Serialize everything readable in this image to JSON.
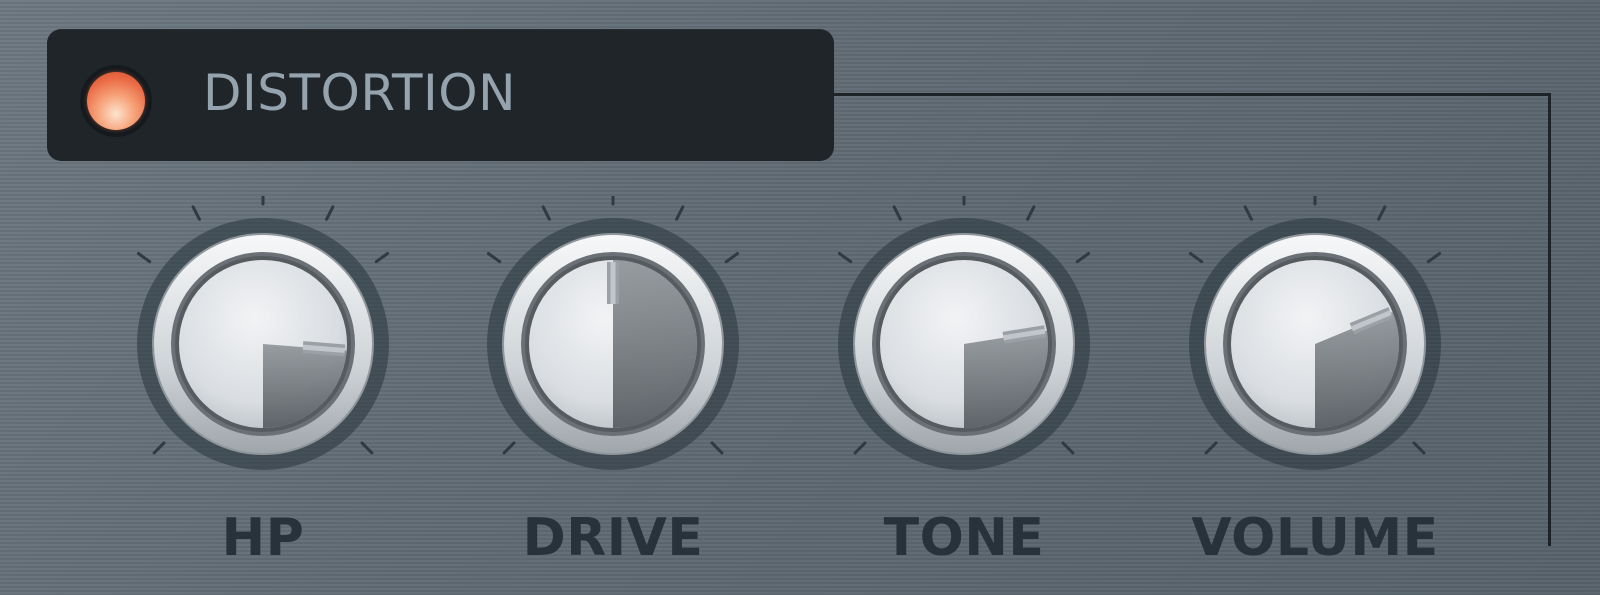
{
  "plugin": {
    "section_title": "DISTORTION",
    "power_led": {
      "state": "on",
      "color": "#ea6a45"
    }
  },
  "knobs": [
    {
      "id": "hp",
      "label": "HP",
      "value": 0.85
    },
    {
      "id": "drive",
      "label": "DRIVE",
      "value": 0.5
    },
    {
      "id": "tone",
      "label": "TONE",
      "value": 0.8
    },
    {
      "id": "volume",
      "label": "VOLUME",
      "value": 0.75
    }
  ],
  "colors": {
    "panel": "#5f6a73",
    "header": "#20252a",
    "title": "#94a3ad",
    "label": "#27323b"
  }
}
